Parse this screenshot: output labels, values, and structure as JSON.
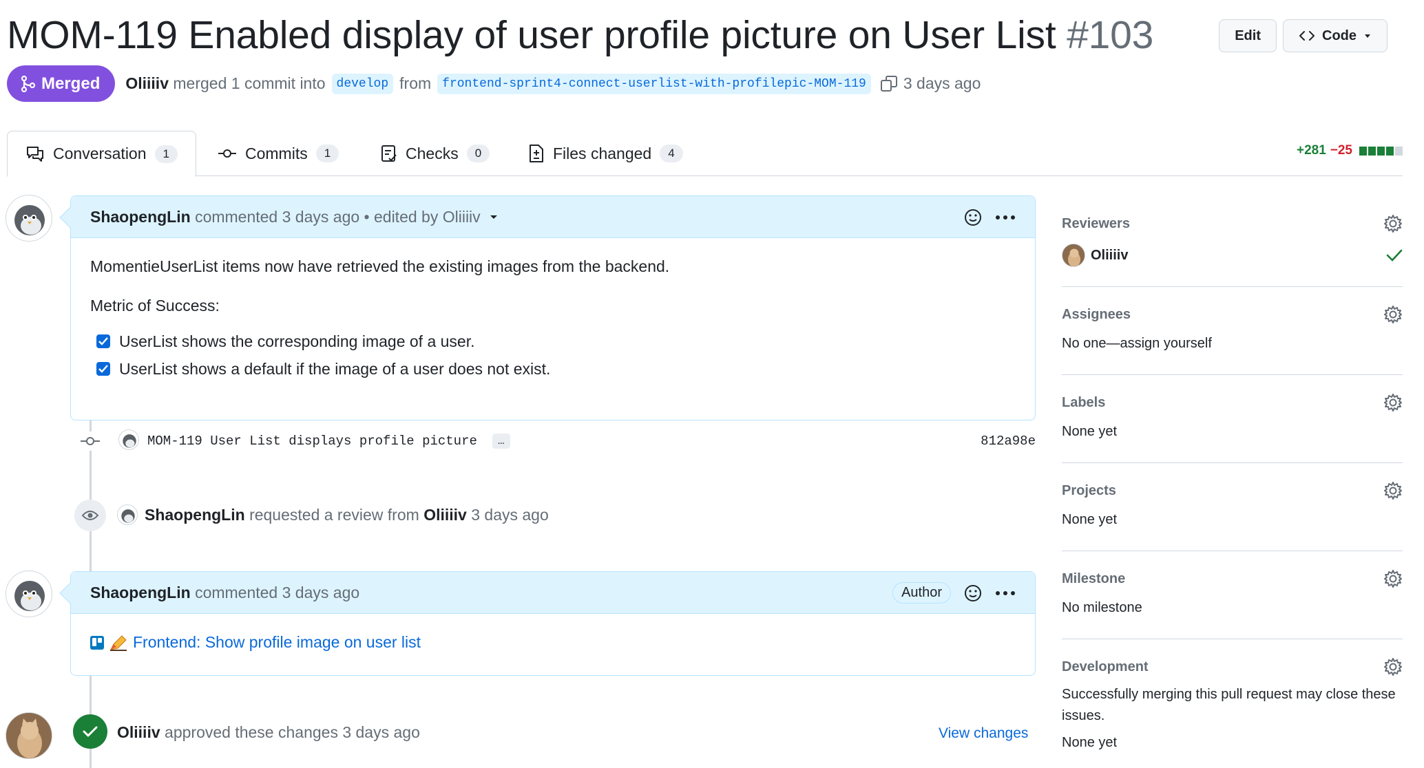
{
  "pr": {
    "title": "MOM-119 Enabled display of user profile picture on User List",
    "number": "#103",
    "edit_label": "Edit",
    "code_label": "Code",
    "state": "Merged",
    "author": "Oliiiiv",
    "merge_text": "merged 1 commit into",
    "base_branch": "develop",
    "from_text": "from",
    "head_branch": "frontend-sprint4-connect-userlist-with-profilepic-MOM-119",
    "time": "3 days ago"
  },
  "tabs": [
    {
      "label": "Conversation",
      "count": "1"
    },
    {
      "label": "Commits",
      "count": "1"
    },
    {
      "label": "Checks",
      "count": "0"
    },
    {
      "label": "Files changed",
      "count": "4"
    }
  ],
  "diffstat": {
    "additions": "+281",
    "deletions": "−25"
  },
  "colors": {
    "accent": "#0969da",
    "merged": "#8250df",
    "success": "#1a7f37",
    "danger": "#cf222e"
  },
  "comment1": {
    "author": "ShaopengLin",
    "meta": "commented 3 days ago • edited by",
    "editor": "Oliiiiv",
    "body": "MomentieUserList items now have retrieved the existing images from the backend.",
    "metric": "Metric of Success:",
    "tasks": [
      "UserList shows the corresponding image of a user.",
      "UserList shows a default if the image of a user does not exist."
    ]
  },
  "commit": {
    "message": "MOM-119 User List displays profile picture",
    "ellipsis": "…",
    "sha": "812a98e"
  },
  "review_request": {
    "actor": "ShaopengLin",
    "text": "requested a review from",
    "reviewer": "Oliiiiv",
    "time": "3 days ago"
  },
  "comment2": {
    "author": "ShaopengLin",
    "meta": "commented 3 days ago",
    "badge": "Author",
    "link": "Frontend: Show profile image on user list"
  },
  "approval": {
    "actor": "Oliiiiv",
    "text": "approved these changes 3 days ago",
    "action": "View changes"
  },
  "sidebar": {
    "reviewers": {
      "title": "Reviewers",
      "name": "Oliiiiv"
    },
    "assignees": {
      "title": "Assignees",
      "text": "No one—assign yourself"
    },
    "labels": {
      "title": "Labels",
      "text": "None yet"
    },
    "projects": {
      "title": "Projects",
      "text": "None yet"
    },
    "milestone": {
      "title": "Milestone",
      "text": "No milestone"
    },
    "development": {
      "title": "Development",
      "text": "Successfully merging this pull request may close these issues.",
      "text2": "None yet"
    }
  }
}
